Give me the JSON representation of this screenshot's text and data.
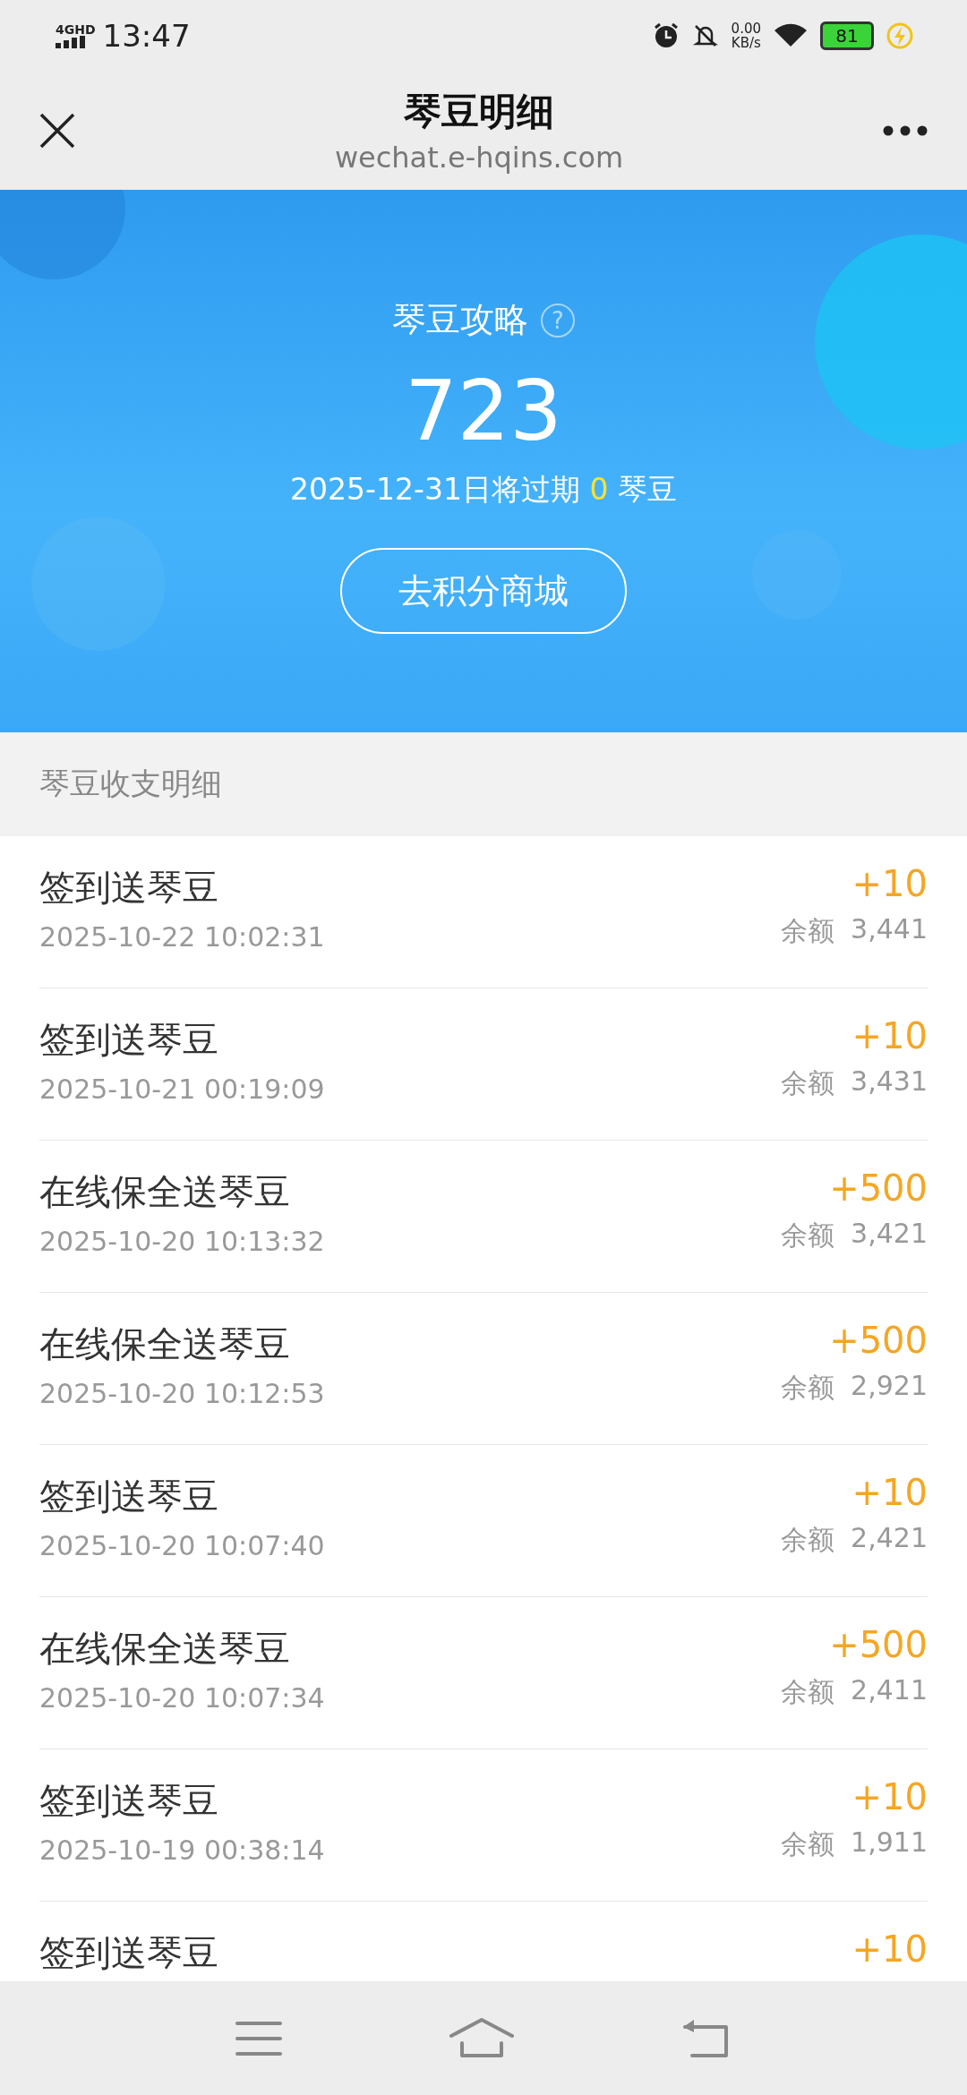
{
  "status_bar": {
    "network": "4GHD",
    "time": "13:47",
    "speed_value": "0.00",
    "speed_unit": "KB/s",
    "battery": "81"
  },
  "header": {
    "title": "琴豆明细",
    "subtitle": "wechat.e-hqins.com"
  },
  "banner": {
    "guide_label": "琴豆攻略",
    "help_icon": "?",
    "balance": "723",
    "expiry_prefix": "2025-12-31日将过期",
    "expiry_amount": "0",
    "expiry_suffix": "琴豆",
    "mall_button": "去积分商城"
  },
  "section_title": "琴豆收支明细",
  "records": [
    {
      "title": "签到送琴豆",
      "time": "2025-10-22 10:02:31",
      "amount": "+10",
      "balance_label": "余额",
      "balance": "3,441"
    },
    {
      "title": "签到送琴豆",
      "time": "2025-10-21 00:19:09",
      "amount": "+10",
      "balance_label": "余额",
      "balance": "3,431"
    },
    {
      "title": "在线保全送琴豆",
      "time": "2025-10-20 10:13:32",
      "amount": "+500",
      "balance_label": "余额",
      "balance": "3,421"
    },
    {
      "title": "在线保全送琴豆",
      "time": "2025-10-20 10:12:53",
      "amount": "+500",
      "balance_label": "余额",
      "balance": "2,921"
    },
    {
      "title": "签到送琴豆",
      "time": "2025-10-20 10:07:40",
      "amount": "+10",
      "balance_label": "余额",
      "balance": "2,421"
    },
    {
      "title": "在线保全送琴豆",
      "time": "2025-10-20 10:07:34",
      "amount": "+500",
      "balance_label": "余额",
      "balance": "2,411"
    },
    {
      "title": "签到送琴豆",
      "time": "2025-10-19 00:38:14",
      "amount": "+10",
      "balance_label": "余额",
      "balance": "1,911"
    },
    {
      "title": "签到送琴豆",
      "amount": "+10"
    }
  ]
}
